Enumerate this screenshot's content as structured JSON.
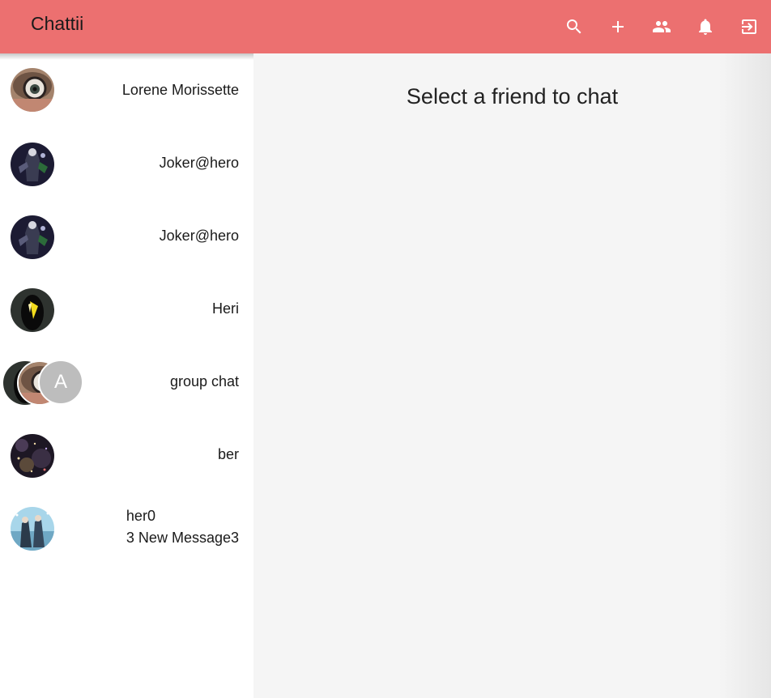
{
  "app": {
    "title": "Chattii",
    "accent": "#ec7070"
  },
  "toolbar": {
    "icons": [
      "search-icon",
      "add-icon",
      "people-icon",
      "notifications-icon",
      "logout-icon"
    ]
  },
  "chats": [
    {
      "name": "Lorene Morissette",
      "avatar": "photo"
    },
    {
      "name": "Joker@hero",
      "avatar": "photo"
    },
    {
      "name": "Joker@hero",
      "avatar": "photo"
    },
    {
      "name": "Heri",
      "avatar": "photo"
    },
    {
      "name": "group chat",
      "avatar": "group",
      "group_letter": "A"
    },
    {
      "name": "ber",
      "avatar": "photo"
    },
    {
      "name": "her0",
      "avatar": "photo",
      "unread": "3 New Message3"
    }
  ],
  "main": {
    "prompt": "Select a friend to chat"
  }
}
